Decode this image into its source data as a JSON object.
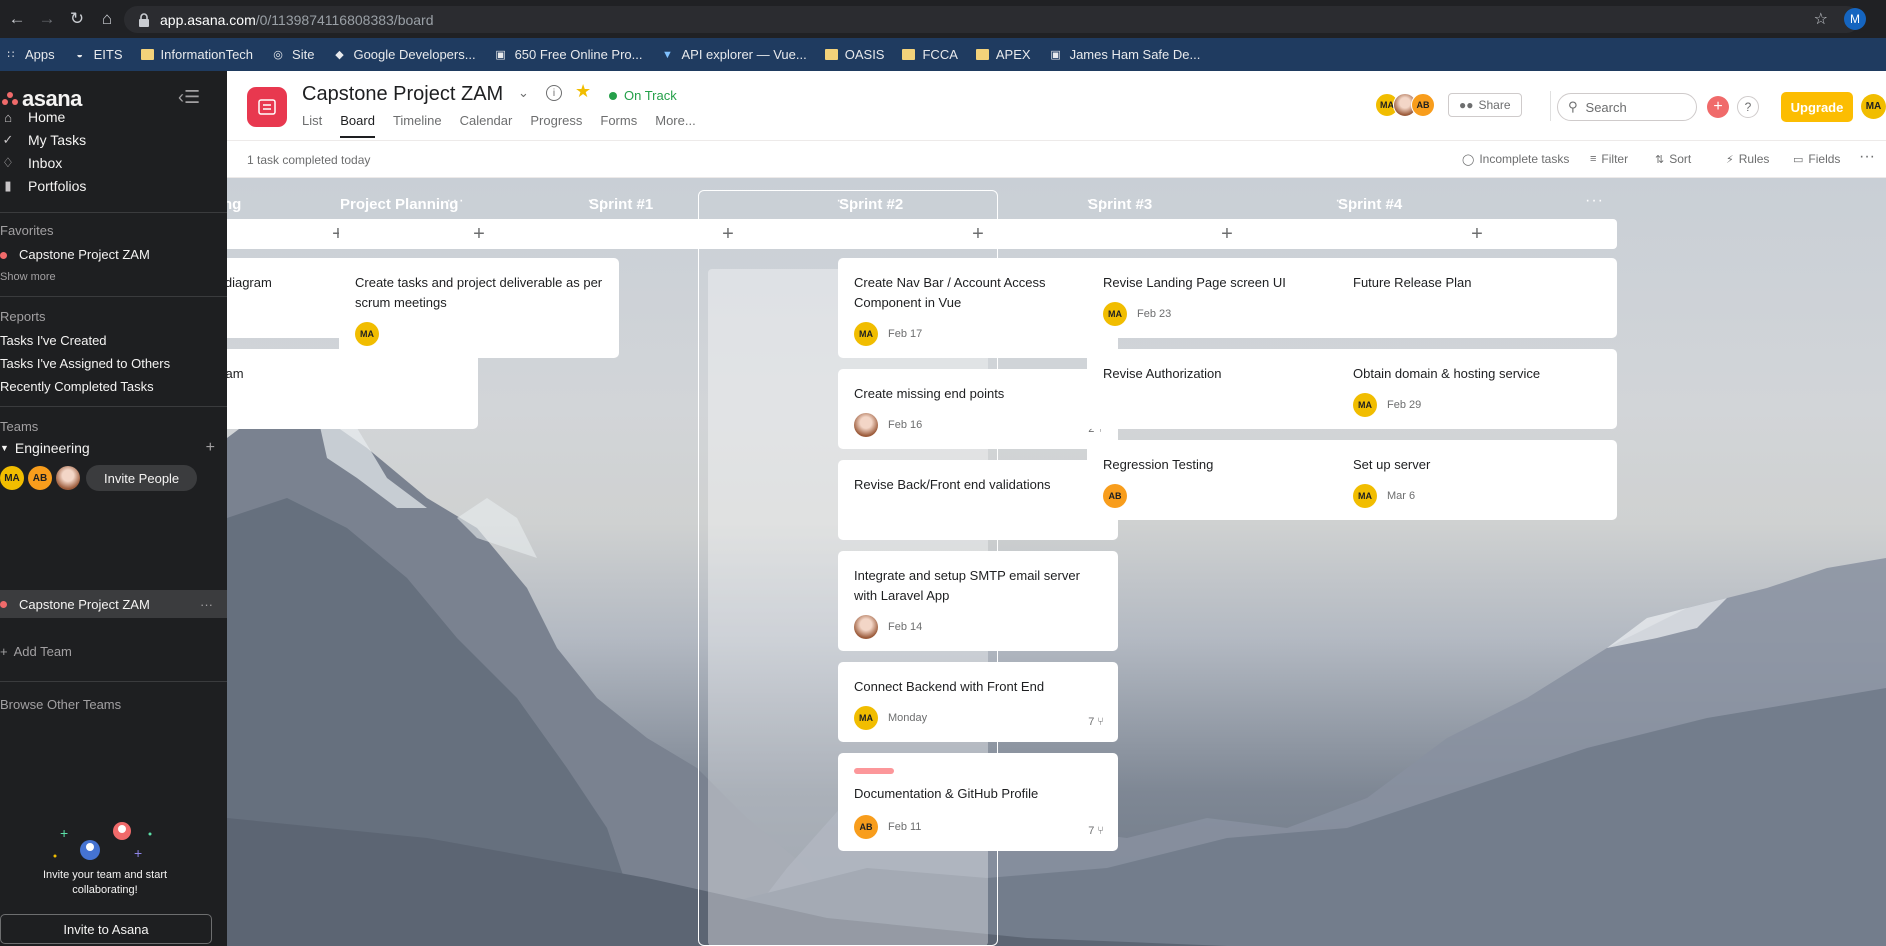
{
  "browser": {
    "url_host": "app.asana.com",
    "url_path": "/0/1139874116808383/board",
    "profile_initial": "M",
    "bookmarks": [
      {
        "label": "Apps",
        "icon": "apps-grid-icon"
      },
      {
        "label": "EITS",
        "icon": "eits-icon"
      },
      {
        "label": "InformationTech",
        "icon": "folder-icon"
      },
      {
        "label": "Site",
        "icon": "globe-icon"
      },
      {
        "label": "Google Developers...",
        "icon": "google-dev-icon"
      },
      {
        "label": "650 Free Online Pro...",
        "icon": "site-icon"
      },
      {
        "label": "API explorer — Vue...",
        "icon": "vue-icon"
      },
      {
        "label": "OASIS",
        "icon": "folder-icon"
      },
      {
        "label": "FCCA",
        "icon": "folder-icon"
      },
      {
        "label": "APEX",
        "icon": "folder-icon"
      },
      {
        "label": "James Ham Safe De...",
        "icon": "site-icon"
      }
    ]
  },
  "sidebar": {
    "logo": "asana",
    "nav": [
      {
        "label": "Home",
        "icon": "home-icon"
      },
      {
        "label": "My Tasks",
        "icon": "check-circle-icon"
      },
      {
        "label": "Inbox",
        "icon": "bell-icon"
      },
      {
        "label": "Portfolios",
        "icon": "bar-chart-icon"
      }
    ],
    "favorites_title": "Favorites",
    "favorites": [
      "Capstone Project ZAM"
    ],
    "show_more": "Show more",
    "reports_title": "Reports",
    "reports": [
      "Tasks I've Created",
      "Tasks I've Assigned to Others",
      "Recently Completed Tasks"
    ],
    "teams_title": "Teams",
    "team_name": "Engineering",
    "team_members": [
      "MA",
      "AB"
    ],
    "invite_people": "Invite People",
    "team_project": "Capstone Project ZAM",
    "add_team": "Add Team",
    "browse_teams": "Browse Other Teams",
    "invite_text": "Invite your team and start collaborating!",
    "invite_button": "Invite to Asana"
  },
  "header": {
    "project_title": "Capstone Project ZAM",
    "status": "On Track",
    "tabs": [
      "List",
      "Board",
      "Timeline",
      "Calendar",
      "Progress",
      "Forms",
      "More..."
    ],
    "active_tab": "Board",
    "members": [
      "MA",
      "",
      "AB"
    ],
    "share": "Share",
    "search_placeholder": "Search",
    "help": "?",
    "upgrade": "Upgrade",
    "me": "MA"
  },
  "toolbar": {
    "completed_today": "1 task completed today",
    "incomplete": "Incomplete tasks",
    "filter": "Filter",
    "sort": "Sort",
    "rules": "Rules",
    "fields": "Fields"
  },
  "colors": {
    "accent_red": "#e8384f",
    "on_track_green": "#25a04a",
    "upgrade_yellow": "#fcbd01",
    "avatar_ma": "#f1bd00",
    "avatar_ab": "#f89d1c"
  },
  "board": {
    "columns": [
      {
        "title": "ng",
        "cards": [
          {
            "title": "e diagram"
          },
          {
            "title": "gram"
          }
        ]
      },
      {
        "title": "Project Planning",
        "cards": [
          {
            "title": "Create tasks and project deliverable as per scrum meetings",
            "assignee": "MA"
          }
        ]
      },
      {
        "title": "Sprint #1",
        "cards": []
      },
      {
        "title": "Sprint #2",
        "cards": [
          {
            "title": "Create Nav Bar / Account Access Component in Vue",
            "assignee": "MA",
            "due": "Feb 17"
          },
          {
            "title": "Create missing end points",
            "assignee": "photo",
            "due": "Feb 16",
            "subtasks": "2"
          },
          {
            "title": "Revise Back/Front end validations"
          },
          {
            "title": "Integrate and setup SMTP email server with Laravel App",
            "assignee": "photo",
            "due": "Feb 14"
          },
          {
            "title": "Connect Backend with Front End",
            "assignee": "MA",
            "due": "Monday",
            "subtasks": "7"
          },
          {
            "title": "Documentation & GitHub Profile",
            "assignee": "AB",
            "due": "Feb 11",
            "subtasks": "7",
            "tag": "pink"
          }
        ]
      },
      {
        "title": "Sprint #3",
        "cards": [
          {
            "title": "Revise Landing Page screen UI",
            "assignee": "MA",
            "due": "Feb 23"
          },
          {
            "title": "Revise Authorization"
          },
          {
            "title": "Regression Testing",
            "assignee": "AB"
          }
        ]
      },
      {
        "title": "Sprint #4",
        "cards": [
          {
            "title": "Future Release Plan"
          },
          {
            "title": "Obtain domain & hosting service",
            "assignee": "MA",
            "due": "Feb 29"
          },
          {
            "title": "Set up server",
            "assignee": "MA",
            "due": "Mar 6"
          }
        ]
      }
    ]
  }
}
